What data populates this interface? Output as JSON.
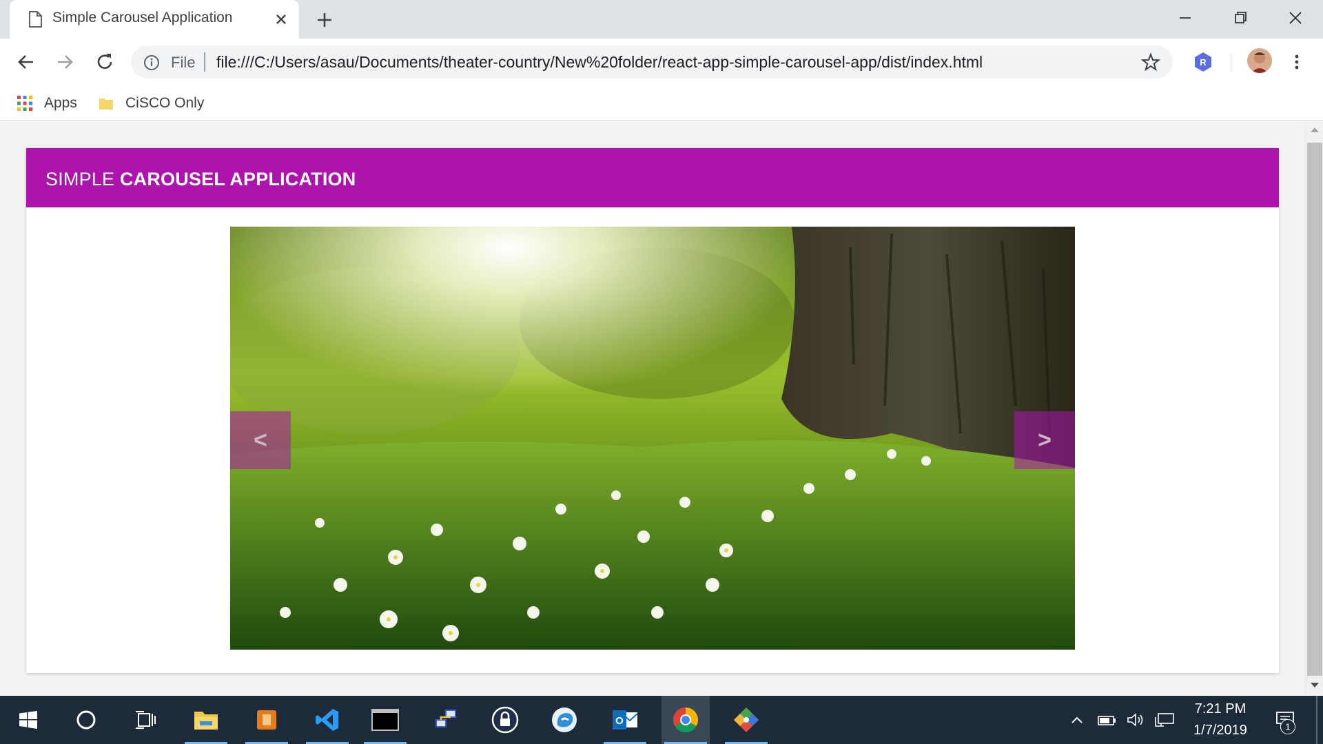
{
  "browser": {
    "tab": {
      "title": "Simple Carousel Application"
    },
    "omnibox": {
      "scheme_label": "File",
      "url": "file:///C:/Users/asau/Documents/theater-country/New%20folder/react-app-simple-carousel-app/dist/index.html"
    },
    "extension_badge": "R",
    "bookmarks": [
      {
        "label": "Apps",
        "icon": "apps-grid-icon"
      },
      {
        "label": "CiSCO Only",
        "icon": "folder-icon"
      }
    ]
  },
  "page": {
    "header": {
      "title_light": "SIMPLE ",
      "title_bold": "CAROUSEL APPLICATION"
    },
    "carousel": {
      "prev_label": "<",
      "next_label": ">",
      "slide_description_icon": "meadow-with-tree-photo"
    },
    "colors": {
      "header_bg": "#ac14ac",
      "nav_button_bg": "rgba(172,20,172,0.55)"
    }
  },
  "taskbar": {
    "apps": [
      {
        "name": "start-button",
        "icon": "windows-logo-icon"
      },
      {
        "name": "cortana-button",
        "icon": "cortana-ring-icon"
      },
      {
        "name": "task-view-button",
        "icon": "task-view-icon"
      },
      {
        "name": "file-explorer",
        "icon": "folder-icon"
      },
      {
        "name": "powerpoint-like-app",
        "icon": "orange-app-icon"
      },
      {
        "name": "vscode",
        "icon": "vscode-icon"
      },
      {
        "name": "terminal",
        "icon": "terminal-icon"
      },
      {
        "name": "network-app",
        "icon": "network-icon"
      },
      {
        "name": "lock-app",
        "icon": "lock-icon"
      },
      {
        "name": "chat-app",
        "icon": "chat-icon"
      },
      {
        "name": "outlook",
        "icon": "outlook-icon"
      },
      {
        "name": "chrome",
        "icon": "chrome-icon"
      },
      {
        "name": "git-app",
        "icon": "git-diamond-icon"
      }
    ],
    "clock": {
      "time": "7:21 PM",
      "date": "1/7/2019"
    },
    "notification_count": "1"
  }
}
